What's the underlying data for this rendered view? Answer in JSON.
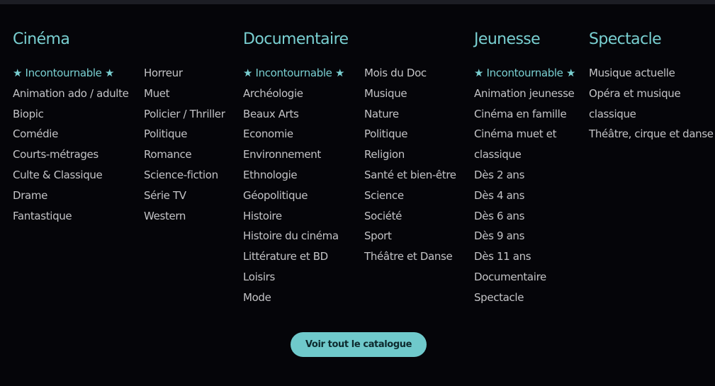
{
  "columns": {
    "cinema": {
      "title": "Cinéma",
      "featured": "★ Incontournable ★",
      "items_a": [
        "Animation ado / adulte",
        "Biopic",
        "Comédie",
        "Courts-métrages",
        "Culte & Classique",
        "Drame",
        "Fantastique"
      ],
      "items_b": [
        "Horreur",
        "Muet",
        "Policier / Thriller",
        "Politique",
        "Romance",
        "Science-fiction",
        "Série TV",
        "Western"
      ]
    },
    "documentaire": {
      "title": "Documentaire",
      "featured": "★ Incontournable ★",
      "items_a": [
        "Archéologie",
        "Beaux Arts",
        "Economie",
        "Environnement",
        "Ethnologie",
        "Géopolitique",
        "Histoire",
        "Histoire du cinéma",
        "Littérature et BD",
        "Loisirs",
        "Mode"
      ],
      "items_b": [
        "Mois du Doc",
        "Musique",
        "Nature",
        "Politique",
        "Religion",
        "Santé et bien-être",
        "Science",
        "Société",
        "Sport",
        "Théâtre et Danse"
      ]
    },
    "jeunesse": {
      "title": "Jeunesse",
      "featured": "★ Incontournable ★",
      "items": [
        "Animation jeunesse",
        "Cinéma en famille",
        "Cinéma muet et classique",
        "Dès 2 ans",
        "Dès 4 ans",
        "Dès 6 ans",
        "Dès 9 ans",
        "Dès 11 ans",
        "Documentaire",
        "Spectacle"
      ]
    },
    "spectacle": {
      "title": "Spectacle",
      "items": [
        "Musique actuelle",
        "Opéra et musique classique",
        "Théâtre, cirque et danse"
      ]
    }
  },
  "catalog_button": "Voir tout le catalogue",
  "colors": {
    "background": "#050509",
    "accent": "#79cfd1",
    "button": "#6fc9cb",
    "text": "#c3c3c6"
  }
}
